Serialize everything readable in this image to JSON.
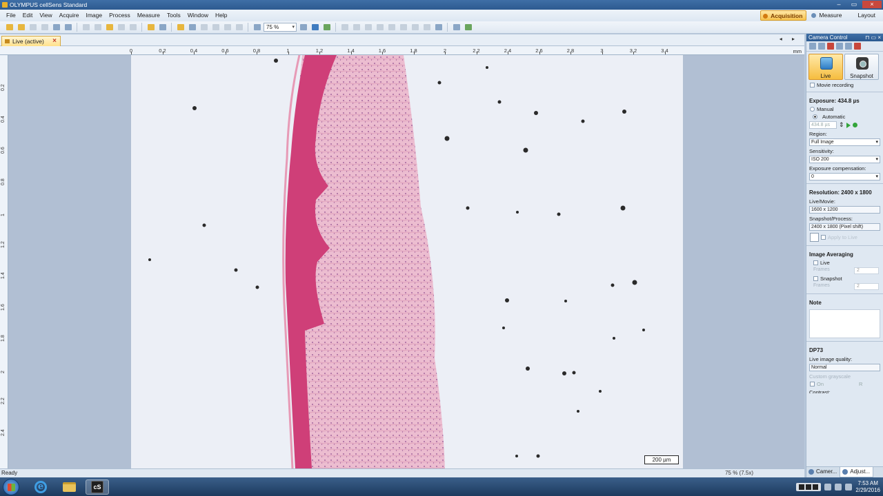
{
  "window": {
    "title": "OLYMPUS cellSens Standard"
  },
  "menu": [
    "File",
    "Edit",
    "View",
    "Acquire",
    "Image",
    "Process",
    "Measure",
    "Tools",
    "Window",
    "Help"
  ],
  "workspaces": [
    {
      "label": "Acquisition",
      "active": true
    },
    {
      "label": "Measure",
      "active": false
    },
    {
      "label": "Layout",
      "active": false
    }
  ],
  "toolbar": {
    "zoom": "75 %"
  },
  "document": {
    "tab_label": "Live (active)",
    "close_symbol": "×",
    "nav_arrows": "◂ ▸"
  },
  "ruler": {
    "unit": "mm",
    "h_ticks": [
      "0",
      "0.2",
      "0.4",
      "0.6",
      "0.8",
      "1",
      "1.2",
      "1.4",
      "1.6",
      "1.8",
      "2",
      "2.2",
      "2.4",
      "2.6",
      "2.8",
      "3",
      "3.2",
      "3.4"
    ],
    "v_ticks": [
      "0.2",
      "0.4",
      "0.6",
      "0.8",
      "1",
      "1.2",
      "1.4",
      "1.6",
      "1.8",
      "2",
      "2.2",
      "2.4"
    ]
  },
  "image": {
    "scalebar": "200 µm",
    "tissue_color": "#e9b3c9",
    "epidermis_color": "#c8356e"
  },
  "status": {
    "text": "Ready",
    "zoom_info": "75 % (7.5x)"
  },
  "panel": {
    "title": "Camera Control",
    "title_buttons": "⊓ ▭ ×",
    "live_label": "Live",
    "snapshot_label": "Snapshot",
    "movie_recording": "Movie recording",
    "exposure_header": "Exposure: 434.8 µs",
    "manual": "Manual",
    "automatic": "Automatic",
    "exposure_value": "434.8 µs",
    "region_label": "Region:",
    "region_value": "Full Image",
    "sensitivity_label": "Sensitivity:",
    "sensitivity_value": "ISO 200",
    "exp_comp_label": "Exposure compensation:",
    "exp_comp_value": "0",
    "resolution_header": "Resolution: 2400 x 1800",
    "live_movie_label": "Live/Movie:",
    "live_movie_value": "1600 x 1200",
    "snapshot_process_label": "Snapshot/Process:",
    "snapshot_process_value": "2400 x 1800 (Pixel shift)",
    "crop_label": "Apply to Live",
    "averaging_header": "Image Averaging",
    "avg_live": "Live",
    "avg_snapshot": "Snapshot",
    "frames_label": "Frames",
    "frames_value": "2",
    "note_header": "Note",
    "camera_header": "DP73",
    "live_quality_label": "Live image quality:",
    "live_quality_value": "Normal",
    "custom_grayscale": "Custom grayscale",
    "on_label": "On",
    "r_label": "R",
    "contrast_label": "Contrast:",
    "tabs": [
      "Camer...",
      "Adjust..."
    ]
  },
  "taskbar": {
    "time": "7:53 AM",
    "date": "2/29/2016"
  }
}
